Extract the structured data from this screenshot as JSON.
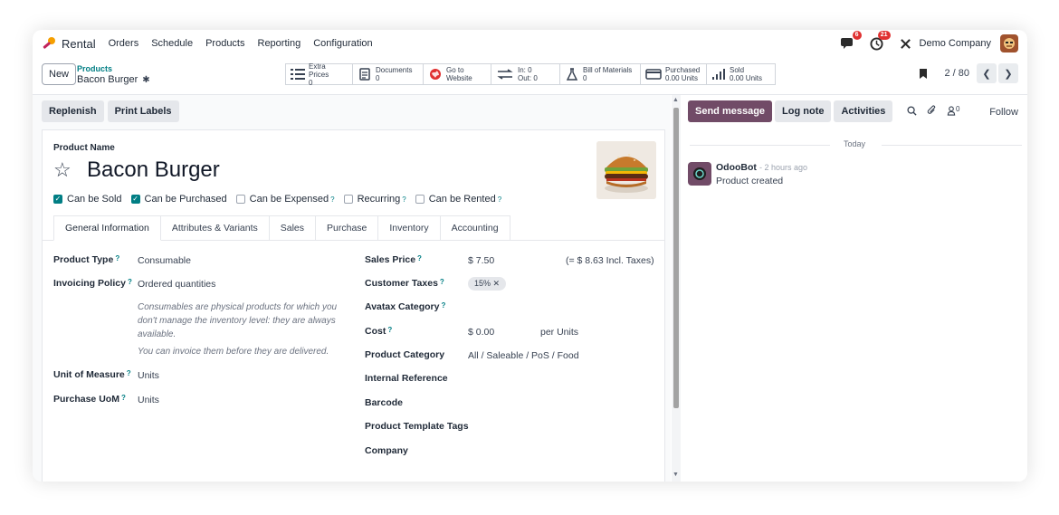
{
  "app": {
    "name": "Rental",
    "menu": [
      "Orders",
      "Schedule",
      "Products",
      "Reporting",
      "Configuration"
    ],
    "messages_badge": "6",
    "activities_badge": "21",
    "company": "Demo Company"
  },
  "control_panel": {
    "new_label": "New",
    "breadcrumb_parent": "Products",
    "breadcrumb_current": "Bacon Burger",
    "pager": "2 / 80"
  },
  "smart_buttons": [
    {
      "icon": "list-icon",
      "label": "Extra Prices",
      "value": "0"
    },
    {
      "icon": "document-icon",
      "label": "Documents",
      "value": "0"
    },
    {
      "icon": "globe-icon",
      "label": "Go to",
      "value": "Website"
    },
    {
      "icon": "transfer-icon",
      "label": "In: 0",
      "value": "Out: 0"
    },
    {
      "icon": "flask-icon",
      "label": "Bill of Materials",
      "value": "0"
    },
    {
      "icon": "card-icon",
      "label": "Purchased",
      "value": "0.00 Units"
    },
    {
      "icon": "bar-chart-icon",
      "label": "Sold",
      "value": "0.00 Units"
    }
  ],
  "actions": {
    "replenish": "Replenish",
    "print_labels": "Print Labels"
  },
  "product": {
    "name_label": "Product Name",
    "name": "Bacon Burger",
    "checkboxes": [
      {
        "label": "Can be Sold",
        "checked": true,
        "help": ""
      },
      {
        "label": "Can be Purchased",
        "checked": true,
        "help": ""
      },
      {
        "label": "Can be Expensed",
        "checked": false,
        "help": "?"
      },
      {
        "label": "Recurring",
        "checked": false,
        "help": "?"
      },
      {
        "label": "Can be Rented",
        "checked": false,
        "help": "?"
      }
    ],
    "tabs": [
      "General Information",
      "Attributes & Variants",
      "Sales",
      "Purchase",
      "Inventory",
      "Accounting"
    ],
    "left_fields": {
      "product_type_label": "Product Type",
      "product_type": "Consumable",
      "invoicing_policy_label": "Invoicing Policy",
      "invoicing_policy": "Ordered quantities",
      "help_1": "Consumables are physical products for which you don't manage the inventory level: they are always available.",
      "help_2": "You can invoice them before they are delivered.",
      "uom_label": "Unit of Measure",
      "uom": "Units",
      "purchase_uom_label": "Purchase UoM",
      "purchase_uom": "Units"
    },
    "right_fields": {
      "sales_price_label": "Sales Price",
      "sales_price": "$ 7.50",
      "incl_taxes": "(= $ 8.63 Incl. Taxes)",
      "customer_taxes_label": "Customer Taxes",
      "customer_tax_tag": "15%",
      "avatax_label": "Avatax Category",
      "cost_label": "Cost",
      "cost": "$ 0.00",
      "cost_per": "per Units",
      "category_label": "Product Category",
      "category": "All / Saleable / PoS / Food",
      "internal_ref_label": "Internal Reference",
      "barcode_label": "Barcode",
      "tags_label": "Product Template Tags",
      "company_label": "Company"
    }
  },
  "chatter": {
    "send_message": "Send message",
    "log_note": "Log note",
    "activities": "Activities",
    "followers_count": "0",
    "follow": "Follow",
    "today": "Today",
    "author": "OdooBot",
    "time": "- 2 hours ago",
    "text": "Product created"
  },
  "colors": {
    "accent": "#017e84",
    "primary": "#714b67",
    "badge": "#e03131"
  }
}
